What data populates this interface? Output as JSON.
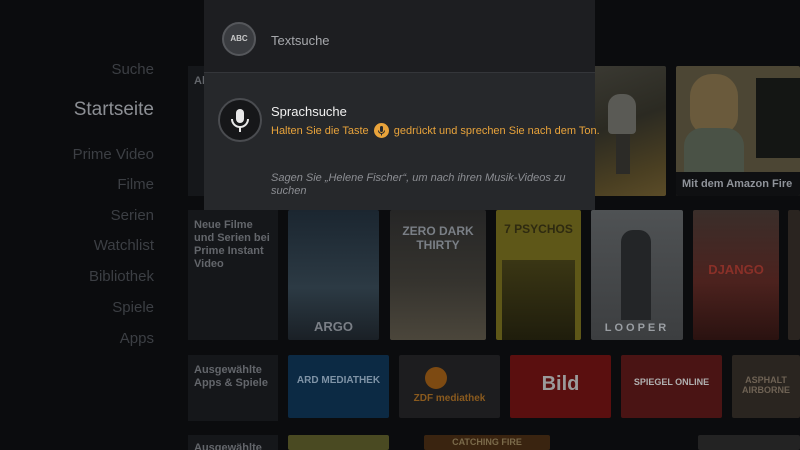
{
  "nav": {
    "items": [
      {
        "label": "Suche",
        "active": false
      },
      {
        "label": "Startseite",
        "active": true
      },
      {
        "label": "Prime Video",
        "active": false
      },
      {
        "label": "Filme",
        "active": false
      },
      {
        "label": "Serien",
        "active": false
      },
      {
        "label": "Watchlist",
        "active": false
      },
      {
        "label": "Bibliothek",
        "active": false
      },
      {
        "label": "Spiele",
        "active": false
      },
      {
        "label": "Apps",
        "active": false
      }
    ]
  },
  "rows": {
    "featured": {
      "label": "Al",
      "tiles": [
        {
          "caption": "",
          "theme": "drama-poster"
        },
        {
          "caption": "Mit dem Amazon Fire",
          "theme": "cartoon-promo"
        }
      ]
    },
    "movies": {
      "label": "Neue Filme und Serien bei Prime Instant Video",
      "tiles": [
        {
          "title": "ARGO",
          "theme": "dark-blue"
        },
        {
          "title": "ZERO DARK THIRTY",
          "theme": "desert"
        },
        {
          "title": "7 PSYCHOS",
          "theme": "yellow"
        },
        {
          "title": "LOOPER",
          "theme": "grey"
        },
        {
          "title": "DJANGO",
          "theme": "red"
        }
      ]
    },
    "apps": {
      "label": "Ausgewählte Apps & Spiele",
      "tiles": [
        {
          "title": "ARD MEDIATHEK",
          "theme": "blue"
        },
        {
          "title": "ZDF mediathek",
          "theme": "orange"
        },
        {
          "title": "Bild",
          "theme": "red"
        },
        {
          "title": "SPIEGEL ONLINE",
          "theme": "dark-red"
        },
        {
          "title": "ASPHALT AIRBORNE",
          "theme": "dark"
        }
      ]
    },
    "more": {
      "label": "Ausgewählte",
      "tiles": [
        {
          "title": "",
          "theme": "yellow"
        },
        {
          "title": "CATCHING FIRE",
          "theme": "orange"
        },
        {
          "title": "",
          "theme": "dark"
        }
      ]
    }
  },
  "overlay": {
    "text_search": {
      "icon": "abc-icon",
      "glyph": "ABC",
      "label": "Textsuche"
    },
    "voice_search": {
      "icon": "microphone-icon",
      "title": "Sprachsuche",
      "hint_before": "Halten Sie die Taste",
      "hint_after": "gedrückt und sprechen Sie nach dem Ton.",
      "example": "Sagen Sie „Helene Fischer“, um nach ihren Musik-Videos zu suchen"
    },
    "colors": {
      "accent": "#e8a33b",
      "panel": "#26282b"
    }
  }
}
